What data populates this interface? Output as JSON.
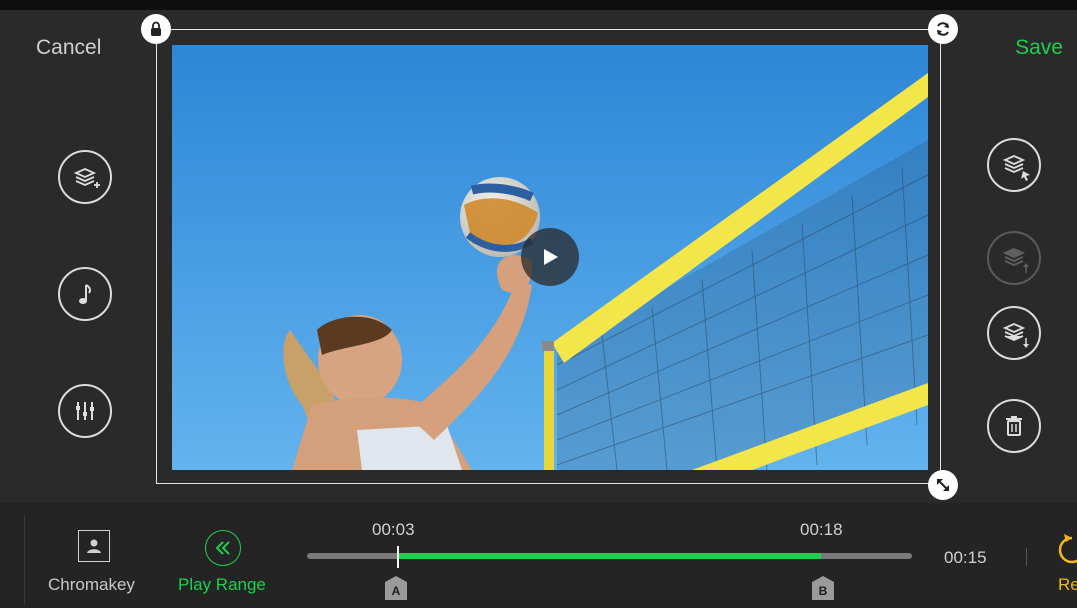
{
  "header": {
    "cancel_label": "Cancel",
    "save_label": "Save"
  },
  "preview": {
    "handles": {
      "top_left": "lock-icon",
      "top_right": "rotate-icon",
      "bottom_right": "resize-icon"
    },
    "play_icon": "play-icon"
  },
  "left_tools": [
    {
      "icon": "add-layer-icon"
    },
    {
      "icon": "music-icon"
    },
    {
      "icon": "equalizer-icon"
    }
  ],
  "right_tools": [
    {
      "icon": "select-layer-icon",
      "enabled": true
    },
    {
      "icon": "layer-up-icon",
      "enabled": false
    },
    {
      "icon": "layer-down-icon",
      "enabled": true
    },
    {
      "icon": "trash-icon",
      "enabled": true
    }
  ],
  "bottom": {
    "chromakey_label": "Chromakey",
    "play_range_label": "Play Range",
    "range": {
      "start_time": "00:03",
      "end_time": "00:18",
      "marker_a": "A",
      "marker_b": "B",
      "duration": "00:15",
      "start_fraction": 0.15,
      "end_fraction": 0.85
    },
    "partial_label": "Re"
  },
  "colors": {
    "accent": "#1ecf4f",
    "partial": "#f1b81a",
    "background": "#2a2a2a"
  }
}
